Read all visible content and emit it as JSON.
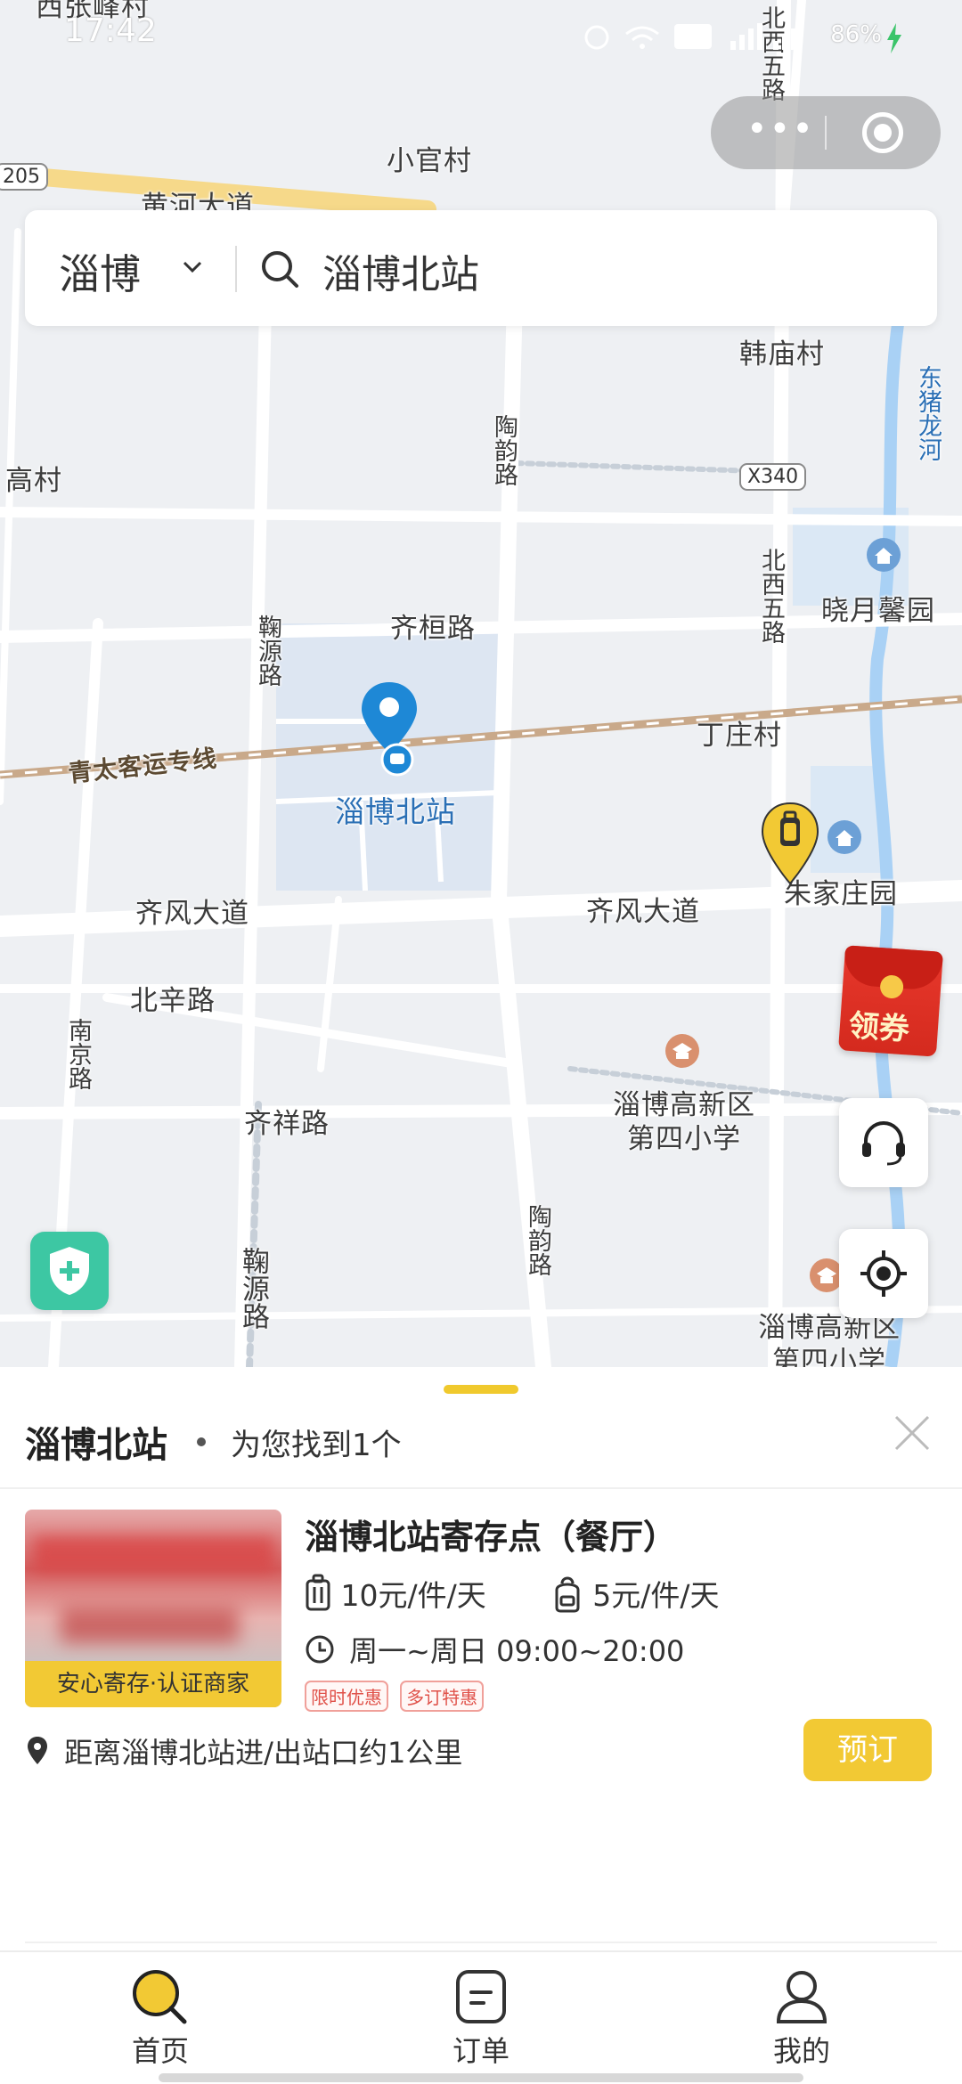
{
  "status_bar": {
    "time": "17:42",
    "battery": "86%"
  },
  "map": {
    "labels": {
      "xiaoguan": "小官村",
      "huanghe": "黄河大道",
      "hanmiao": "韩庙村",
      "gao": "高村",
      "taoyun_north": "陶韵路",
      "beixi_north": "北西五路",
      "beixi_top": "北西五路",
      "road_x340": "X340",
      "road_205": "205",
      "dongzhu": "东猪龙河",
      "xiaoyue": "晓月馨园",
      "qihuan": "齐桓路",
      "juyuan_north": "鞠源路",
      "railway": "青太客运专线",
      "dingzhuang": "丁庄村",
      "station": "淄博北站",
      "zhujia": "朱家庄园",
      "qifeng_west": "齐风大道",
      "qifeng_east": "齐风大道",
      "beixin": "北辛路",
      "nanjing": "南京路",
      "school": "淄博高新区第四小学",
      "school2": "淄博高新区第四小学",
      "qixiang": "齐祥路",
      "taoyun_south": "陶韵路",
      "juyuan_south": "鞠源路",
      "top_left": "西张峰村"
    }
  },
  "search": {
    "city": "淄博",
    "query": "淄博北站"
  },
  "coupon": {
    "label": "领券"
  },
  "result": {
    "station": "淄博北站",
    "count_text": "为您找到1个"
  },
  "store": {
    "badge": "安心寄存·认证商家",
    "name": "淄博北站寄存点（餐厅）",
    "price_luggage": "10元/件/天",
    "price_bag": "5元/件/天",
    "hours": "周一~周日 09:00~20:00",
    "tags": [
      "限时优惠",
      "多订特惠"
    ],
    "distance": "距离淄博北站进/出站口约1公里",
    "book_label": "预订"
  },
  "tabs": [
    {
      "label": "首页",
      "icon": "search-icon"
    },
    {
      "label": "订单",
      "icon": "order-icon"
    },
    {
      "label": "我的",
      "icon": "user-icon"
    }
  ],
  "colors": {
    "accent": "#f2c934",
    "map_bg": "#eef0f3",
    "pin_blue": "#1e88d6",
    "shield": "#3dc7a3"
  }
}
